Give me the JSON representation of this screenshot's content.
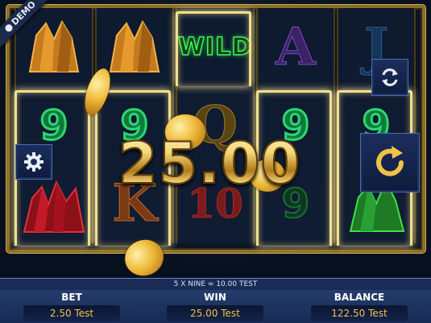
{
  "demo_badge": "DEMO",
  "reels": {
    "row1": [
      "crystal-orange",
      "crystal-orange",
      "WILD",
      "A",
      "J"
    ],
    "row2": [
      "9",
      "9",
      "Q",
      "9",
      "9"
    ],
    "row3": [
      "crystal-red",
      "K",
      "10",
      "9",
      "crystal-green"
    ]
  },
  "wild_label": "WILD",
  "win_overlay": "25.00",
  "info_line": "5 X NINE = 10.00 TEST",
  "bottom": {
    "bet_label": "BET",
    "bet_value": "2.50 Test",
    "win_label": "WIN",
    "win_value": "25.00 Test",
    "balance_label": "BALANCE",
    "balance_value": "122.50 Test"
  },
  "icons": [
    "settings-gear-icon",
    "autoplay-icon",
    "spin-icon"
  ],
  "colors": {
    "accent_gold": "#f0c24a",
    "bar_blue": "#1d3566"
  }
}
